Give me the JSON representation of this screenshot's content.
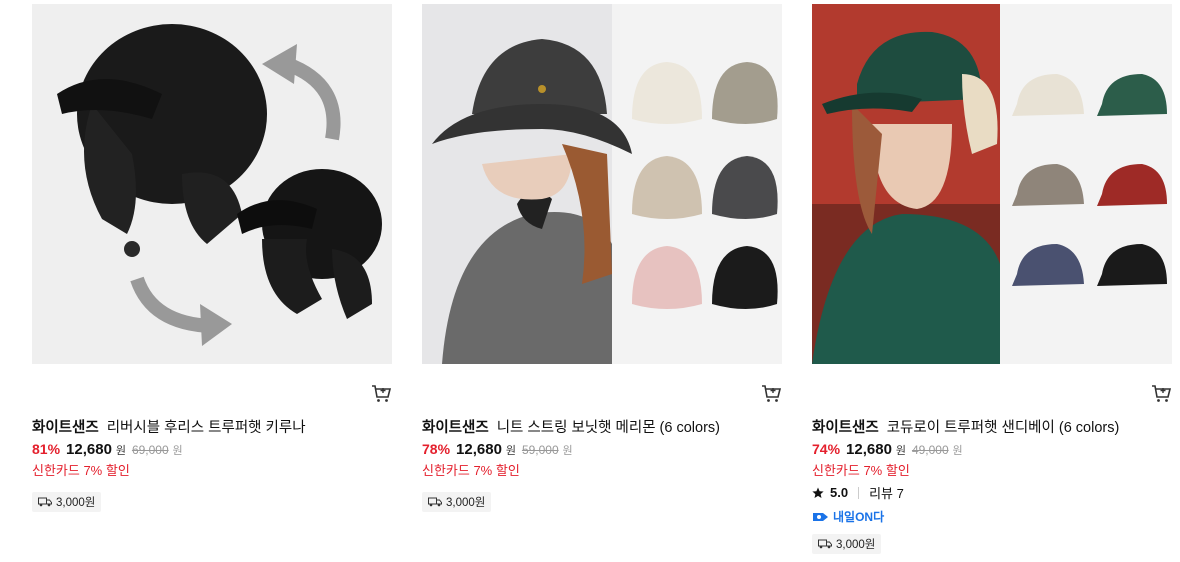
{
  "products": [
    {
      "brand": "화이트샌즈",
      "name": "리버시블 후리스 트루퍼햇 키루나",
      "discount": "81%",
      "price": "12,680",
      "price_unit": "원",
      "original_price": "69,000",
      "original_unit": "원",
      "card_promo": "신한카드 7% 할인",
      "shipping": "3,000원",
      "image_icon": "black-trooper-hat-image"
    },
    {
      "brand": "화이트샌즈",
      "name": "니트 스트링 보닛햇 메리몬 (6 colors)",
      "discount": "78%",
      "price": "12,680",
      "price_unit": "원",
      "original_price": "59,000",
      "original_unit": "원",
      "card_promo": "신한카드 7% 할인",
      "shipping": "3,000원",
      "image_icon": "bucket-hat-image"
    },
    {
      "brand": "화이트샌즈",
      "name": "코듀로이 트루퍼햇 샌디베이 (6 colors)",
      "discount": "74%",
      "price": "12,680",
      "price_unit": "원",
      "original_price": "49,000",
      "original_unit": "원",
      "card_promo": "신한카드 7% 할인",
      "rating": "5.0",
      "review_label": "리뷰 7",
      "delivery_badge": "내일ON다",
      "shipping": "3,000원",
      "image_icon": "corduroy-trooper-hat-image"
    }
  ],
  "colors": {
    "discount": "#e4202d",
    "promo": "#e4202d",
    "delivery": "#1a73e8"
  },
  "icons": {
    "cart": "cart-icon",
    "truck": "truck-icon",
    "star": "star-icon",
    "delivery": "rocket-delivery-icon"
  }
}
